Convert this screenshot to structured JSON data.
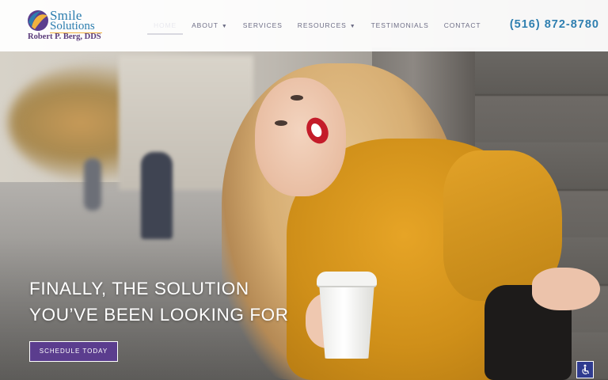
{
  "brand": {
    "line1": "Smile",
    "line2": "Solutions",
    "doctor": "Robert P. Berg, DDS"
  },
  "nav": {
    "items": [
      {
        "label": "HOME",
        "active": true,
        "dropdown": false
      },
      {
        "label": "ABOUT",
        "active": false,
        "dropdown": true
      },
      {
        "label": "SERVICES",
        "active": false,
        "dropdown": false
      },
      {
        "label": "RESOURCES",
        "active": false,
        "dropdown": true
      },
      {
        "label": "TESTIMONIALS",
        "active": false,
        "dropdown": false
      },
      {
        "label": "CONTACT",
        "active": false,
        "dropdown": false
      }
    ],
    "caret_icon": "caret-down-icon"
  },
  "phone": "(516) 872-8780",
  "hero": {
    "headline_line1": "FINALLY, THE SOLUTION",
    "headline_line2": "YOU’VE BEEN LOOKING FOR",
    "cta_label": "SCHEDULE TODAY"
  },
  "accessibility": {
    "icon": "accessibility-icon"
  },
  "colors": {
    "brand_blue": "#2c7dae",
    "brand_purple": "#5b3d8e",
    "accent_gold": "#f1b23e",
    "nav_text": "#6e6e86"
  }
}
